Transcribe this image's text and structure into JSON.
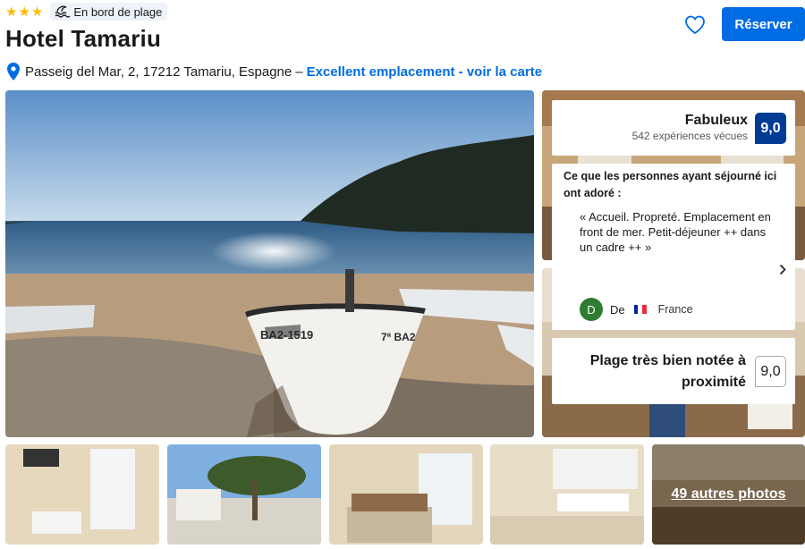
{
  "header": {
    "star_count": 3,
    "star_color": "#febb02",
    "beach_badge_label": "En bord de plage",
    "beach_badge_icon": "beach-waves-icon",
    "title": "Hotel Tamariu",
    "address": "Passeig del Mar, 2, 17212 Tamariu, Espagne",
    "address_separator": "–",
    "map_link": "Excellent emplacement - voir la carte",
    "save_icon": "heart-icon",
    "reserve_label": "Réserver"
  },
  "reviews": {
    "rating_label": "Fabuleux",
    "review_count": "542 expériences vécues",
    "score": "9,0",
    "liked_heading": "Ce que les personnes ayant séjourné ici ont adoré :",
    "quote": "« Accueil. Propreté. Emplacement en front de mer. Petit-déjeuner ++ dans un cadre ++ »",
    "reviewer_initial": "D",
    "reviewer_prefix": "De",
    "reviewer_country": "France",
    "next_icon": "chevron-right-icon",
    "beach_label": "Plage très bien notée à proximité",
    "beach_score": "9,0"
  },
  "gallery": {
    "more_photos": "49 autres photos"
  },
  "colors": {
    "accent": "#006ce4",
    "score_badge": "#003b95",
    "avatar": "#2e7d32"
  }
}
